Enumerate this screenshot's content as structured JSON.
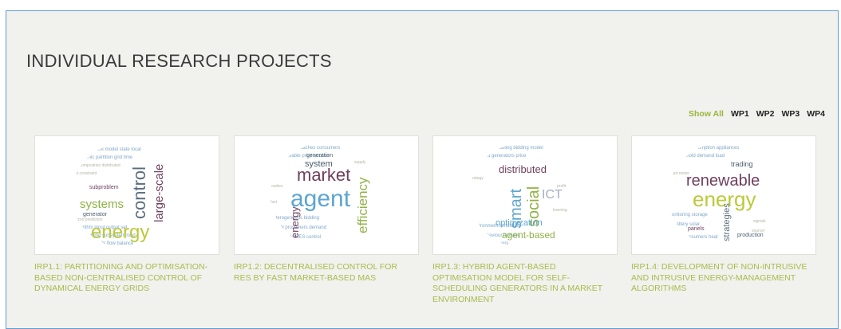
{
  "section": {
    "title": "INDIVIDUAL RESEARCH PROJECTS"
  },
  "filters": [
    "Show All",
    "WP1",
    "WP2",
    "WP3",
    "WP4"
  ],
  "colors": {
    "accent": "#a8bc4a",
    "border": "#5f9ed4",
    "background": "#f1f1ee"
  },
  "projects": [
    {
      "title": "IRP1.1: PARTITIONING AND OPTIMISATION-BASED NON-CENTRALISED CONTROL OF DYNAMICAL ENERGY GRIDS",
      "cloud_words": [
        "control",
        "large-scale",
        "systems",
        "energy",
        "generator",
        "subproblem"
      ]
    },
    {
      "title": "IRP1.2: DECENTRALISED CONTROL FOR RES BY FAST MARKET-BASED MAS",
      "cloud_words": [
        "market",
        "agent",
        "efficiency",
        "system",
        "energy",
        "generation"
      ]
    },
    {
      "title": "IRP1.3: HYBRID AGENT-BASED OPTIMISATION MODEL FOR SELF-SCHEDULING GENERATORS IN A MARKET ENVIRONMENT",
      "cloud_words": [
        "distributed",
        "smart",
        "social",
        "ICT",
        "optimization",
        "agent-based"
      ]
    },
    {
      "title": "IRP1.4: DEVELOPMENT OF NON-INTRUSIVE AND INTRUSIVE ENERGY-MANAGEMENT ALGORITHMS",
      "cloud_words": [
        "renewable",
        "energy",
        "trading",
        "strategies",
        "panels",
        "production"
      ]
    }
  ]
}
